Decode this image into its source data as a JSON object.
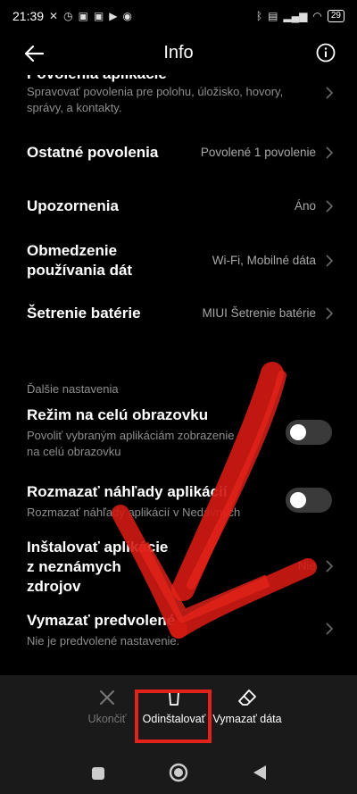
{
  "status_bar": {
    "time": "21:39",
    "battery": "29"
  },
  "header": {
    "title": "Info"
  },
  "rows": {
    "app_permissions": {
      "title": "Povolenia aplikácie",
      "desc_line1": "Spravovať povolenia pre polohu, úložisko, hovory,",
      "desc_line2": "správy, a kontakty."
    },
    "other_permissions": {
      "title": "Ostatné povolenia",
      "value": "Povolené 1 povolenie"
    },
    "notifications": {
      "title": "Upozornenia",
      "value": "Áno"
    },
    "data_usage": {
      "title_line1": "Obmedzenie",
      "title_line2": "používania dát",
      "value": "Wi-Fi, Mobilné dáta"
    },
    "battery_saver": {
      "title": "Šetrenie batérie",
      "value": "MIUI Šetrenie batérie"
    }
  },
  "section": {
    "label": "Ďalšie nastavenia"
  },
  "advanced": {
    "fullscreen": {
      "title": "Režim na celú obrazovku",
      "desc_line1": "Povoliť vybraným aplikáciám zobrazenie",
      "desc_line2": "na celú obrazovku"
    },
    "blur_previews": {
      "title": "Rozmazať náhľady aplikácií",
      "desc": "Rozmazať náhľady aplikácií v Nedávnych"
    },
    "unknown_sources": {
      "title_line1": "Inštalovať aplikácie",
      "title_line2": "z neznámych",
      "title_line3": "zdrojov",
      "value": "Nie"
    },
    "clear_defaults": {
      "title": "Vymazať predvolené",
      "desc": "Nie je predvolené nastavenie."
    }
  },
  "bottom_actions": {
    "stop": "Ukončiť",
    "uninstall": "Odinštalovať",
    "clear_data": "Vymazať dáta"
  },
  "colors": {
    "background": "#000000",
    "bottom_bar": "#1a1a1a",
    "annotation_red": "#e2231a",
    "secondary_text": "#8e8e8e"
  }
}
